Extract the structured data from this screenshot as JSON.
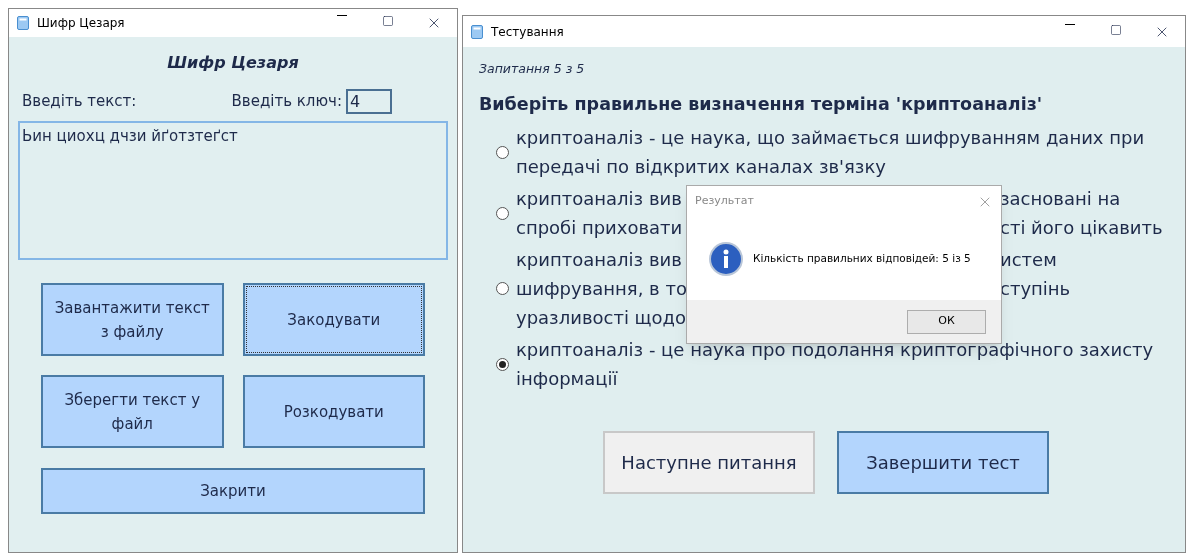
{
  "cipher_window": {
    "title": "Шифр Цезаря",
    "heading": "Шифр Цезаря",
    "text_label": "Введіть текст:",
    "key_label": "Введіть ключ:",
    "key_value": "4",
    "text_value": "Ьин циохц дчзи йґотзтеґст",
    "buttons": [
      {
        "label": "Завантажити текст з файлу",
        "focused": false
      },
      {
        "label": "Закодувати",
        "focused": true
      },
      {
        "label": "Зберегти текст у файл",
        "focused": false
      },
      {
        "label": "Розкодувати",
        "focused": false
      }
    ],
    "close_button": "Закрити"
  },
  "test_window": {
    "title": "Тестування",
    "progress": "Запитання 5 з 5",
    "question": "Виберіть правильне визначення терміна 'криптоаналіз'",
    "options": [
      {
        "selected": false,
        "lines": [
          {
            "before": "криптоаналіз - це наука, що займається шифруванням даних при"
          },
          {
            "before": "передачі по відкритих каналах зв'язку"
          }
        ]
      },
      {
        "selected": false,
        "lines": [
          {
            "before": "криптоаналіз вив",
            "after": "засновані на"
          },
          {
            "before": "спробі приховати",
            "after": "сті його цікавить"
          }
        ]
      },
      {
        "selected": false,
        "lines": [
          {
            "before": "криптоаналіз вив",
            "after": "истем"
          },
          {
            "before": "шифрування, в то",
            "after": "ступінь"
          },
          {
            "before": "уразливості щодо"
          }
        ]
      },
      {
        "selected": true,
        "lines": [
          {
            "before": "криптоаналіз - це наука про подолання криптографічного захисту"
          },
          {
            "before": "інформації"
          }
        ]
      }
    ],
    "buttons": [
      {
        "label": "Наступне питання",
        "primary": false
      },
      {
        "label": "Завершити тест",
        "primary": true
      }
    ]
  },
  "dialog": {
    "title": "Результат",
    "message": "Кількість правильних відповідей: 5 із 5",
    "ok": "ОК"
  }
}
